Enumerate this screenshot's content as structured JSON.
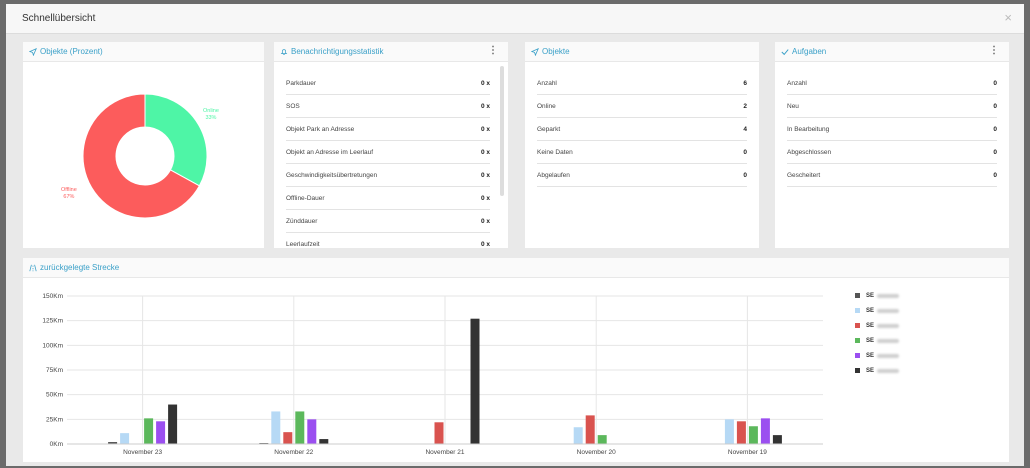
{
  "modal": {
    "title": "Schnellübersicht",
    "close": "×"
  },
  "cards": {
    "objekte_prozent": {
      "title": "Objekte (Prozent)",
      "labels": {
        "online": "Online",
        "online_pct": "33%",
        "offline": "Offline",
        "offline_pct": "67%"
      }
    },
    "benachrichtigung": {
      "title": "Benachrichtigungsstatistik",
      "menu": "⋮",
      "rows": [
        {
          "label": "Parkdauer",
          "value": "0 x"
        },
        {
          "label": "SOS",
          "value": "0 x"
        },
        {
          "label": "Objekt Park an Adresse",
          "value": "0 x"
        },
        {
          "label": "Objekt an Adresse im Leerlauf",
          "value": "0 x"
        },
        {
          "label": "Geschwindigkeitsübertretungen",
          "value": "0 x"
        },
        {
          "label": "Offline-Dauer",
          "value": "0 x"
        },
        {
          "label": "Zünddauer",
          "value": "0 x"
        },
        {
          "label": "Leerlaufzeit",
          "value": "0 x"
        }
      ]
    },
    "objekte": {
      "title": "Objekte",
      "rows": [
        {
          "label": "Anzahl",
          "value": "6"
        },
        {
          "label": "Online",
          "value": "2"
        },
        {
          "label": "Geparkt",
          "value": "4"
        },
        {
          "label": "Keine Daten",
          "value": "0"
        },
        {
          "label": "Abgelaufen",
          "value": "0"
        }
      ]
    },
    "aufgaben": {
      "title": "Aufgaben",
      "menu": "⋮",
      "rows": [
        {
          "label": "Anzahl",
          "value": "0"
        },
        {
          "label": "Neu",
          "value": "0"
        },
        {
          "label": "In Bearbeitung",
          "value": "0"
        },
        {
          "label": "Abgeschlossen",
          "value": "0"
        },
        {
          "label": "Gescheitert",
          "value": "0"
        }
      ]
    },
    "strecke": {
      "title": "zurückgelegte Strecke"
    }
  },
  "colors": {
    "online": "#4ef5a6",
    "offline": "#fc5c5c",
    "accent": "#3aa0c8",
    "series": [
      "#555555",
      "#b6d9f5",
      "#d9534f",
      "#5cb85c",
      "#9b4ff0",
      "#333333"
    ]
  },
  "chart_data": [
    {
      "type": "pie",
      "title": "",
      "slices": [
        {
          "name": "Online",
          "value": 33
        },
        {
          "name": "Offline",
          "value": 67
        }
      ]
    },
    {
      "type": "bar",
      "title": "",
      "categories": [
        "November 23",
        "November 22",
        "November 21",
        "November 20",
        "November 19"
      ],
      "y_ticks": [
        "0Km",
        "25Km",
        "50Km",
        "75Km",
        "100Km",
        "125Km",
        "150Km"
      ],
      "ylim": [
        0,
        150
      ],
      "grid": true,
      "legend": "right",
      "series": [
        {
          "label": "SE",
          "values": [
            2,
            1,
            0,
            0,
            0
          ]
        },
        {
          "label": "SE",
          "values": [
            11,
            33,
            0,
            17,
            25
          ]
        },
        {
          "label": "SE",
          "values": [
            0,
            12,
            22,
            29,
            23
          ]
        },
        {
          "label": "SE",
          "values": [
            26,
            33,
            0,
            9,
            18
          ]
        },
        {
          "label": "SE",
          "values": [
            23,
            25,
            0,
            0,
            26
          ]
        },
        {
          "label": "SE",
          "values": [
            40,
            5,
            127,
            0,
            9
          ]
        }
      ]
    }
  ]
}
